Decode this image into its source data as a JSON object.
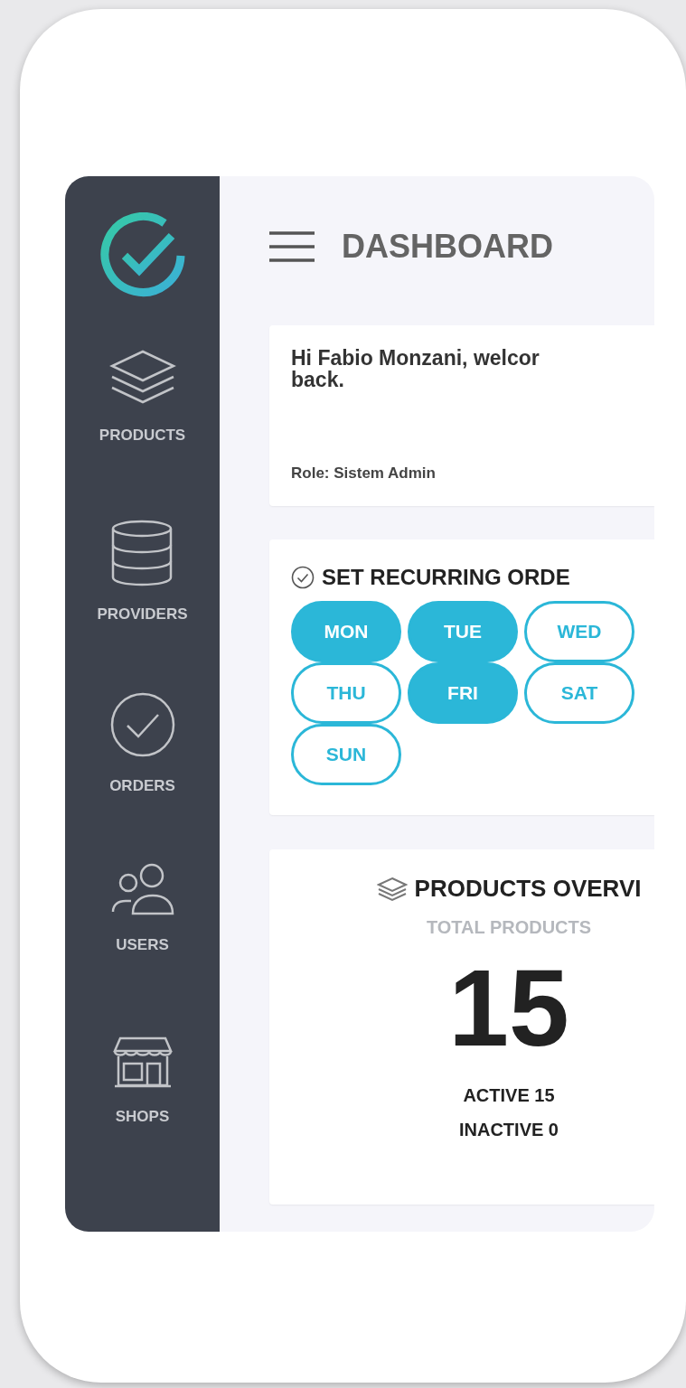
{
  "sidebar": {
    "items": [
      {
        "kind": "layers",
        "label": "PRODUCTS"
      },
      {
        "kind": "database",
        "label": "PROVIDERS"
      },
      {
        "kind": "check",
        "label": "ORDERS"
      },
      {
        "kind": "users",
        "label": "USERS"
      },
      {
        "kind": "shop",
        "label": "SHOPS"
      }
    ]
  },
  "header": {
    "title": "DASHBOARD"
  },
  "welcome": {
    "greeting": "Hi Fabio Monzani, welcor\nback.",
    "role": "Role: Sistem Admin"
  },
  "recurring": {
    "title": "SET RECURRING ORDE",
    "days": [
      {
        "label": "MON",
        "selected": true
      },
      {
        "label": "TUE",
        "selected": true
      },
      {
        "label": "WED",
        "selected": false
      },
      {
        "label": "THU",
        "selected": false
      },
      {
        "label": "FRI",
        "selected": true
      },
      {
        "label": "SAT",
        "selected": false
      },
      {
        "label": "SUN",
        "selected": false
      }
    ]
  },
  "overview": {
    "title": "PRODUCTS OVERVI",
    "subtitle": "TOTAL PRODUCTS",
    "total": "15",
    "active": "ACTIVE 15",
    "inactive": "INACTIVE 0"
  }
}
